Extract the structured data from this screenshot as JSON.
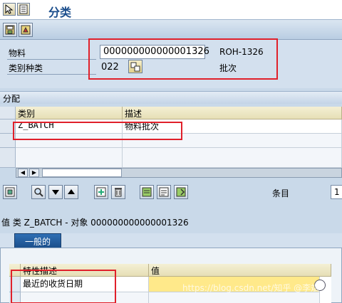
{
  "window": {
    "title": "分类"
  },
  "header": {
    "material_label": "物料",
    "material_value": "000000000000001326",
    "material_desc": "ROH-1326",
    "class_type_label": "类别种类",
    "class_type_value": "022",
    "class_type_desc": "批次"
  },
  "assignment": {
    "section_label": "分配",
    "columns": [
      "类别",
      "描述"
    ],
    "rows": [
      {
        "class": "Z_BATCH",
        "desc": "物料批次"
      }
    ]
  },
  "toolbar2": {
    "entry_label": "条目",
    "entry_value": "1"
  },
  "values": {
    "title": "值 类 Z_BATCH - 对象 000000000000001326",
    "tab_label": "一般的",
    "columns": [
      "特性描述",
      "值"
    ],
    "rows": [
      {
        "char": "最近的收货日期",
        "value": ""
      }
    ]
  },
  "watermark": "https://blog.csdn.net/知乎 @李斌"
}
